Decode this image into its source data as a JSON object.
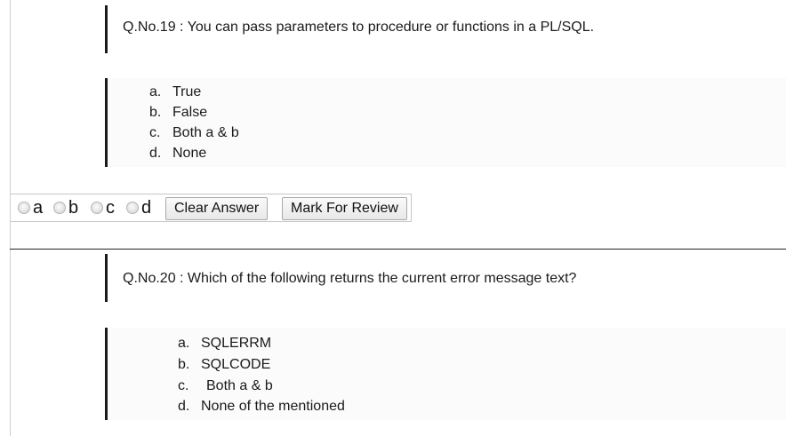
{
  "questions": [
    {
      "title": "Q.No.19 : You can pass parameters to procedure or functions in a PL/SQL.",
      "options": [
        {
          "letter": "a.",
          "text": "True"
        },
        {
          "letter": "b.",
          "text": "False"
        },
        {
          "letter": "c.",
          "text": "Both a & b"
        },
        {
          "letter": "d.",
          "text": "None"
        }
      ]
    },
    {
      "title": "Q.No.20 : Which of the following returns the current error message text?",
      "options": [
        {
          "letter": "a.",
          "text": "SQLERRM"
        },
        {
          "letter": "b.",
          "text": "SQLCODE"
        },
        {
          "letter": "c.",
          "text": "Both a & b"
        },
        {
          "letter": "d.",
          "text": "None of the mentioned"
        }
      ]
    }
  ],
  "answer_bar": {
    "radio_labels": [
      "a",
      "b",
      "c",
      "d"
    ],
    "clear_label": "Clear Answer",
    "review_label": "Mark For Review"
  }
}
